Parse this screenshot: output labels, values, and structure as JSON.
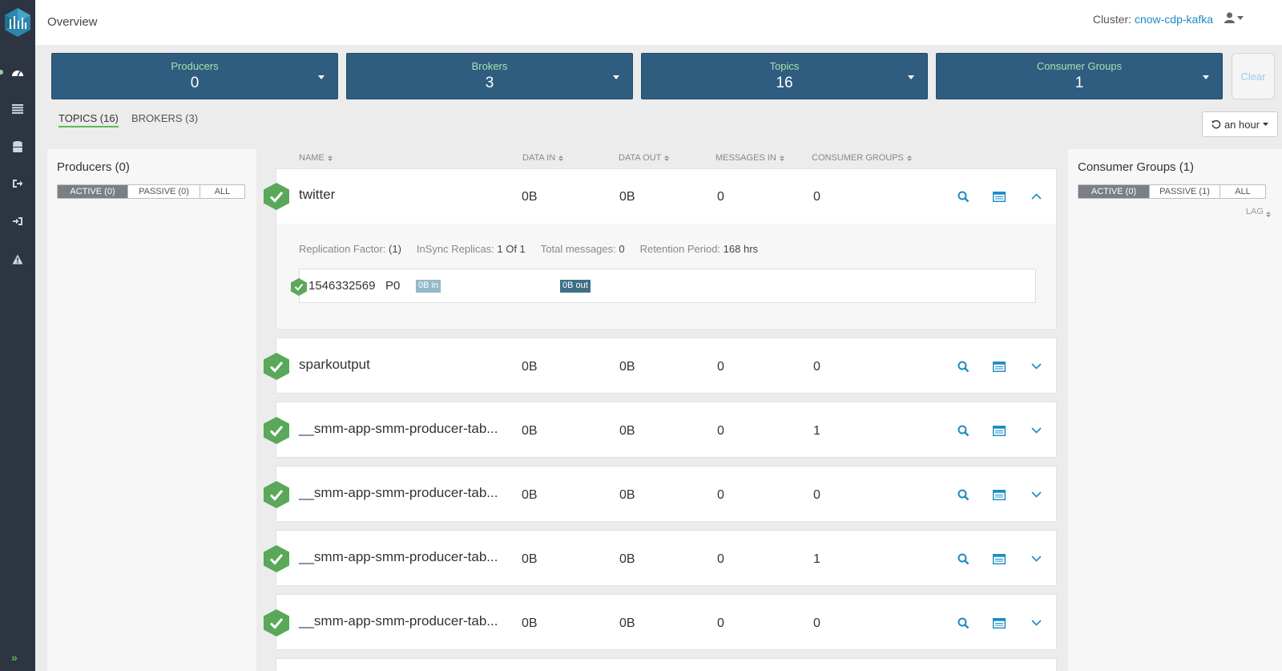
{
  "header": {
    "title": "Overview",
    "cluster_label": "Cluster:",
    "cluster_name": "cnow-cdp-kafka"
  },
  "stats": [
    {
      "label": "Producers",
      "value": "0"
    },
    {
      "label": "Brokers",
      "value": "3"
    },
    {
      "label": "Topics",
      "value": "16"
    },
    {
      "label": "Consumer Groups",
      "value": "1"
    }
  ],
  "clear_label": "Clear",
  "tabs": [
    "TOPICS (16)",
    "BROKERS (3)"
  ],
  "time_range": "an hour",
  "producers_panel": {
    "title": "Producers (0)",
    "filters": [
      "ACTIVE (0)",
      "PASSIVE (0)",
      "ALL"
    ]
  },
  "consumers_panel": {
    "title": "Consumer Groups (1)",
    "filters": [
      "ACTIVE (0)",
      "PASSIVE (1)",
      "ALL"
    ],
    "sort_label": "LAG"
  },
  "columns": [
    "NAME",
    "DATA IN",
    "DATA OUT",
    "MESSAGES IN",
    "CONSUMER GROUPS"
  ],
  "topics": [
    {
      "name": "twitter",
      "data_in": "0B",
      "data_out": "0B",
      "messages_in": "0",
      "consumer_groups": "0"
    },
    {
      "name": "sparkoutput",
      "data_in": "0B",
      "data_out": "0B",
      "messages_in": "0",
      "consumer_groups": "0"
    },
    {
      "name": "__smm-app-smm-producer-tab...",
      "data_in": "0B",
      "data_out": "0B",
      "messages_in": "0",
      "consumer_groups": "1"
    },
    {
      "name": "__smm-app-smm-producer-tab...",
      "data_in": "0B",
      "data_out": "0B",
      "messages_in": "0",
      "consumer_groups": "0"
    },
    {
      "name": "__smm-app-smm-producer-tab...",
      "data_in": "0B",
      "data_out": "0B",
      "messages_in": "0",
      "consumer_groups": "1"
    },
    {
      "name": "__smm-app-smm-producer-tab...",
      "data_in": "0B",
      "data_out": "0B",
      "messages_in": "0",
      "consumer_groups": "0"
    }
  ],
  "expanded": {
    "replication_label": "Replication Factor:",
    "replication_value": "(1)",
    "insync_label": "InSync Replicas:",
    "insync_value": "1 Of 1",
    "total_label": "Total messages:",
    "total_value": "0",
    "retention_label": "Retention Period:",
    "retention_value": "168 hrs",
    "partition": {
      "id": "1546332569",
      "name": "P0",
      "in": "0B in",
      "out": "0B out"
    }
  },
  "colors": {
    "accent_green": "#5cb85c",
    "stat_bg": "#2f5d80",
    "link": "#1b8bc4",
    "sidebar": "#2d3542"
  }
}
